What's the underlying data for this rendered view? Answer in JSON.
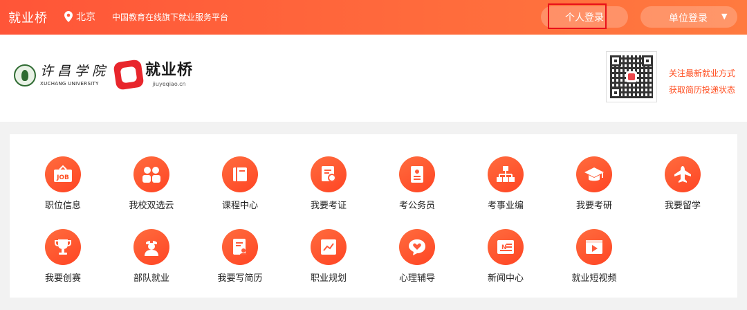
{
  "topbar": {
    "brand": "就业桥",
    "location": "北京",
    "tagline": "中国教育在线旗下就业服务平台",
    "personal_login": "个人登录",
    "unit_login": "单位登录",
    "caret": "▼"
  },
  "header": {
    "xuchang_cn": "许昌学院",
    "xuchang_en": "XUCHANG UNIVERSITY",
    "jyq_name": "就业桥",
    "jyq_url": "jiuyeqiao.cn",
    "follow_line1": "关注最新就业方式",
    "follow_line2": "获取简历投递状态"
  },
  "services": [
    {
      "label": "职位信息",
      "icon": "job-board-icon"
    },
    {
      "label": "我校双选云",
      "icon": "people-icon"
    },
    {
      "label": "课程中心",
      "icon": "book-icon"
    },
    {
      "label": "我要考证",
      "icon": "certificate-icon"
    },
    {
      "label": "考公务员",
      "icon": "id-card-icon"
    },
    {
      "label": "考事业编",
      "icon": "org-chart-icon"
    },
    {
      "label": "我要考研",
      "icon": "graduation-cap-icon"
    },
    {
      "label": "我要留学",
      "icon": "airplane-icon"
    },
    {
      "label": "我要创赛",
      "icon": "trophy-icon"
    },
    {
      "label": "部队就业",
      "icon": "soldier-icon"
    },
    {
      "label": "我要写简历",
      "icon": "resume-icon"
    },
    {
      "label": "职业规划",
      "icon": "chart-icon"
    },
    {
      "label": "心理辅导",
      "icon": "heart-chat-icon"
    },
    {
      "label": "新闻中心",
      "icon": "newspaper-icon"
    },
    {
      "label": "就业短视频",
      "icon": "video-icon"
    }
  ],
  "colors": {
    "topbar": "#ff5a3a",
    "accent": "#ff4e20",
    "highlight_box": "#e8101a"
  }
}
